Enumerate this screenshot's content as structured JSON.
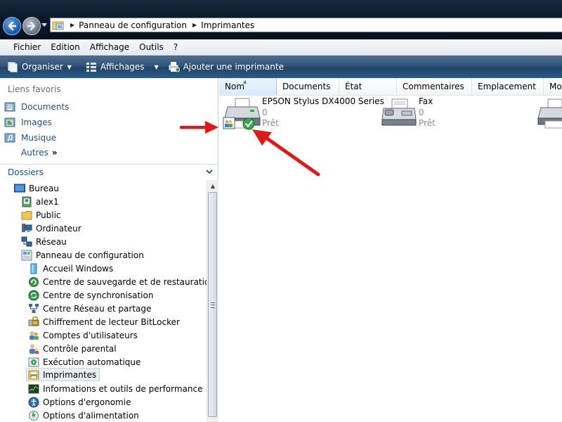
{
  "address": {
    "crumbs": [
      "Panneau de configuration",
      "Imprimantes"
    ]
  },
  "menu": {
    "items": [
      "Fichier",
      "Edition",
      "Affichage",
      "Outils",
      "?"
    ]
  },
  "toolbar": {
    "organize_label": "Organiser",
    "views_label": "Affichages",
    "add_printer_label": "Ajouter une imprimante"
  },
  "favorites": {
    "heading": "Liens favoris",
    "links": [
      "Documents",
      "Images",
      "Musique"
    ],
    "more": "Autres",
    "more_glyph": "»"
  },
  "folders": {
    "heading": "Dossiers",
    "tree": [
      {
        "label": "Bureau",
        "icon": "desktop-icon",
        "level": 0
      },
      {
        "label": "alex1",
        "icon": "user-folder-icon",
        "level": 1
      },
      {
        "label": "Public",
        "icon": "folder-icon",
        "level": 1
      },
      {
        "label": "Ordinateur",
        "icon": "computer-icon",
        "level": 1
      },
      {
        "label": "Réseau",
        "icon": "network-icon",
        "level": 1
      },
      {
        "label": "Panneau de configuration",
        "icon": "control-panel-icon",
        "level": 1
      },
      {
        "label": "Accueil Windows",
        "icon": "welcome-center-icon",
        "level": 2
      },
      {
        "label": "Centre de sauvegarde et de restauration",
        "icon": "backup-icon",
        "level": 2
      },
      {
        "label": "Centre de synchronisation",
        "icon": "sync-icon",
        "level": 2
      },
      {
        "label": "Centre Réseau et partage",
        "icon": "network-sharing-icon",
        "level": 2
      },
      {
        "label": "Chiffrement de lecteur BitLocker",
        "icon": "bitlocker-icon",
        "level": 2
      },
      {
        "label": "Comptes d'utilisateurs",
        "icon": "user-accounts-icon",
        "level": 2
      },
      {
        "label": "Contrôle parental",
        "icon": "parental-controls-icon",
        "level": 2
      },
      {
        "label": "Exécution automatique",
        "icon": "autoplay-icon",
        "level": 2
      },
      {
        "label": "Imprimantes",
        "icon": "printers-icon",
        "level": 2,
        "selected": true
      },
      {
        "label": "Informations et outils de performance",
        "icon": "performance-icon",
        "level": 2
      },
      {
        "label": "Options d'ergonomie",
        "icon": "ease-of-access-icon",
        "level": 2
      },
      {
        "label": "Options d'alimentation",
        "icon": "power-options-icon",
        "level": 2
      }
    ]
  },
  "columns": [
    "Nom",
    "Documents",
    "État",
    "Commentaires",
    "Emplacement",
    "Mo"
  ],
  "printers": [
    {
      "name": "EPSON Stylus DX4000 Series",
      "documents": "0",
      "state": "Prêt",
      "icon": "printer-icon",
      "default": true,
      "shared": true
    },
    {
      "name": "Fax",
      "documents": "0",
      "state": "Prêt",
      "icon": "fax-icon"
    },
    {
      "name": "",
      "documents": "",
      "state": "",
      "icon": "printer-icon"
    }
  ],
  "colors": {
    "link": "#1f4c8f",
    "annotation_arrow": "#e01818",
    "command_bar": "#2f5378"
  }
}
